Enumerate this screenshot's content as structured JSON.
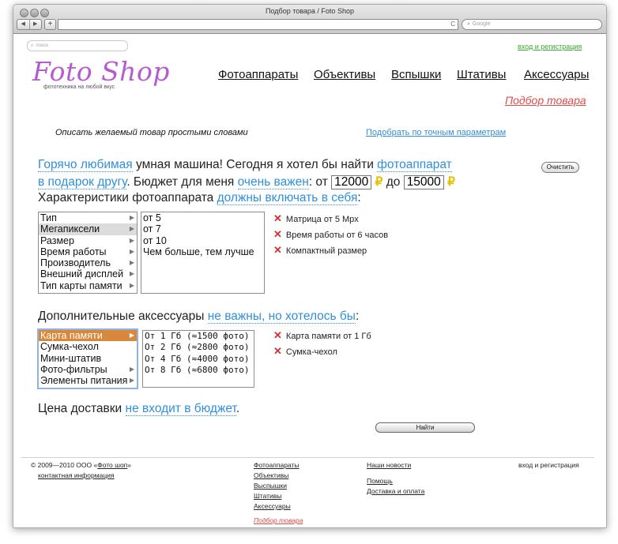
{
  "browser": {
    "title": "Подбор товара / Foto Shop",
    "back": "◀",
    "forward": "▶",
    "new_tab": "+",
    "reload": "C",
    "search_placeholder": "Google"
  },
  "header": {
    "search_placeholder": "поиск",
    "login": "вход и регистрация",
    "logo": "Foto Shop",
    "tagline": "фототехника на любой вкус",
    "nav": [
      "Фотоаппараты",
      "Объективы",
      "Вспышки",
      "Штативы",
      "Аксессуары"
    ],
    "podbor": "Подбор товара"
  },
  "mode": {
    "describe": "Описать желаемый товар простыми словами",
    "exact": "Подобрать по точным параметрам"
  },
  "sentence": {
    "p1": "Горячо любимая",
    "p2": " умная машина! Сегодня я хотел бы найти ",
    "p3": "фотоаппарат",
    "p4": "в подарок другу",
    "p5": ". Бюджет для меня ",
    "p6": "очень важен",
    "p7": ": от ",
    "budget_from": "12000",
    "currency": "₽",
    "p8": " до ",
    "budget_to": "15000",
    "p9": "Характеристики фотоаппарата ",
    "p10": "должны включать в себя",
    "p11": ":",
    "clear": "Очистить"
  },
  "characteristics": {
    "categories": [
      "Тип",
      "Мегапиксели",
      "Размер",
      "Время работы",
      "Производитель",
      "Внешний дисплей",
      "Тип карты памяти"
    ],
    "arrow": "▶",
    "values": [
      "от 5",
      "от 7",
      "от 10",
      "Чем больше, тем лучше"
    ],
    "chosen": [
      "Матрица от 5 Mpx",
      "Время работы от 6 часов",
      "Компактный размер"
    ],
    "remove": "✕"
  },
  "accessories": {
    "s1": "Дополнительные аксессуары ",
    "s2": "не важны, но хотелось бы",
    "s3": ":",
    "categories": [
      "Карта памяти",
      "Сумка-чехол",
      "Мини-штатив",
      "Фото-фильтры",
      "Элементы питания"
    ],
    "values": [
      "От 1 Гб (≈1500 фото)",
      "От 2 Гб (≈2800 фото)",
      "От 4 Гб (≈4000 фото)",
      "От 8 Гб (≈6800 фото)"
    ],
    "chosen": [
      "Карта памяти от 1 Гб",
      "Сумка-чехол"
    ]
  },
  "delivery": {
    "s1": "Цена доставки ",
    "s2": "не входит в бюджет",
    "s3": "."
  },
  "find": "Найти",
  "footer": {
    "copyright": "© 2009—2010 ООО «",
    "company": "Фото шоп",
    "copyright_end": "»",
    "contacts": "контактная информация",
    "col1": [
      "Фотоаппараты",
      "Объективы",
      "Выспышки",
      "Штативы",
      "Аксессуары"
    ],
    "podbor": "Подбор товара",
    "col2": [
      "Наши новости",
      "Помощь",
      "Доставка и оплата"
    ],
    "login": "вход и регистрация"
  }
}
